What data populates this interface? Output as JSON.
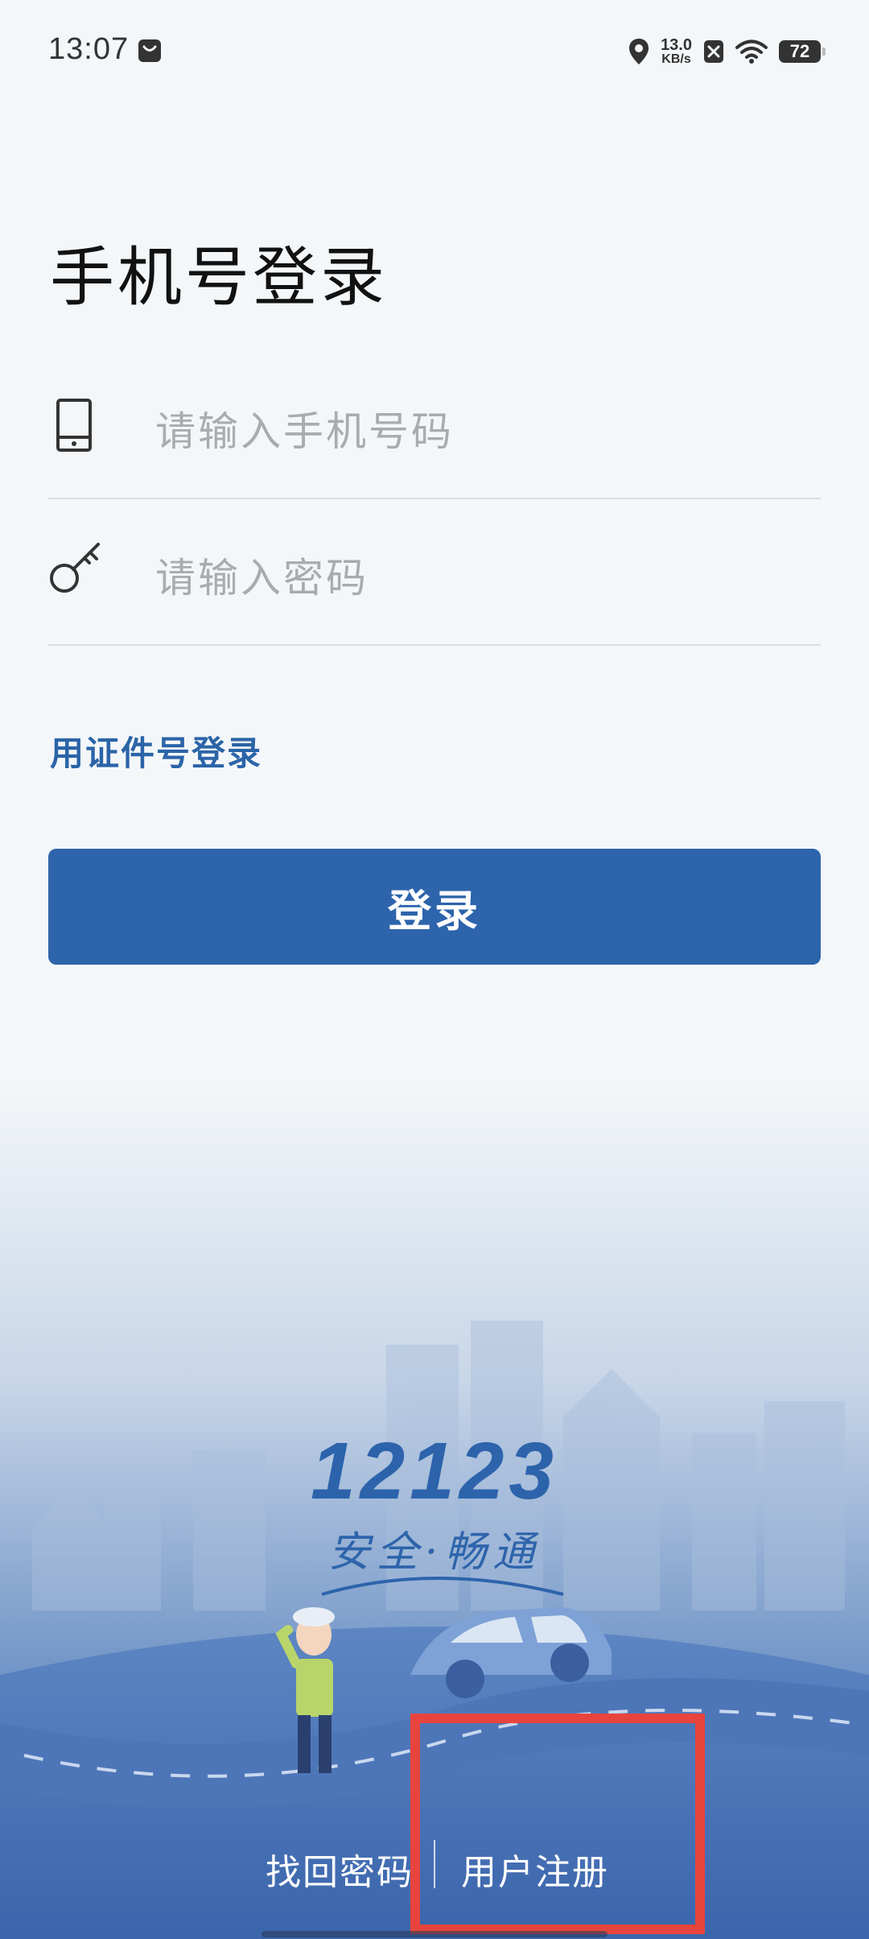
{
  "status_bar": {
    "time": "13:07",
    "net_speed_value": "13.0",
    "net_speed_unit": "KB/s",
    "battery": "72",
    "icons": [
      "bag-icon",
      "location-icon",
      "sim-off-icon",
      "wifi-icon",
      "battery-icon"
    ]
  },
  "page": {
    "title": "手机号登录",
    "phone_placeholder": "请输入手机号码",
    "password_placeholder": "请输入密码",
    "alt_login": "用证件号登录",
    "login_button": "登录"
  },
  "brand": {
    "logo": "12123",
    "slogan": "安全·畅通"
  },
  "bottom_links": {
    "forgot": "找回密码",
    "register": "用户注册"
  },
  "colors": {
    "primary": "#2d64ab",
    "link": "#2b64a8",
    "background": "#f4f7f9",
    "highlight": "#e8443e"
  }
}
